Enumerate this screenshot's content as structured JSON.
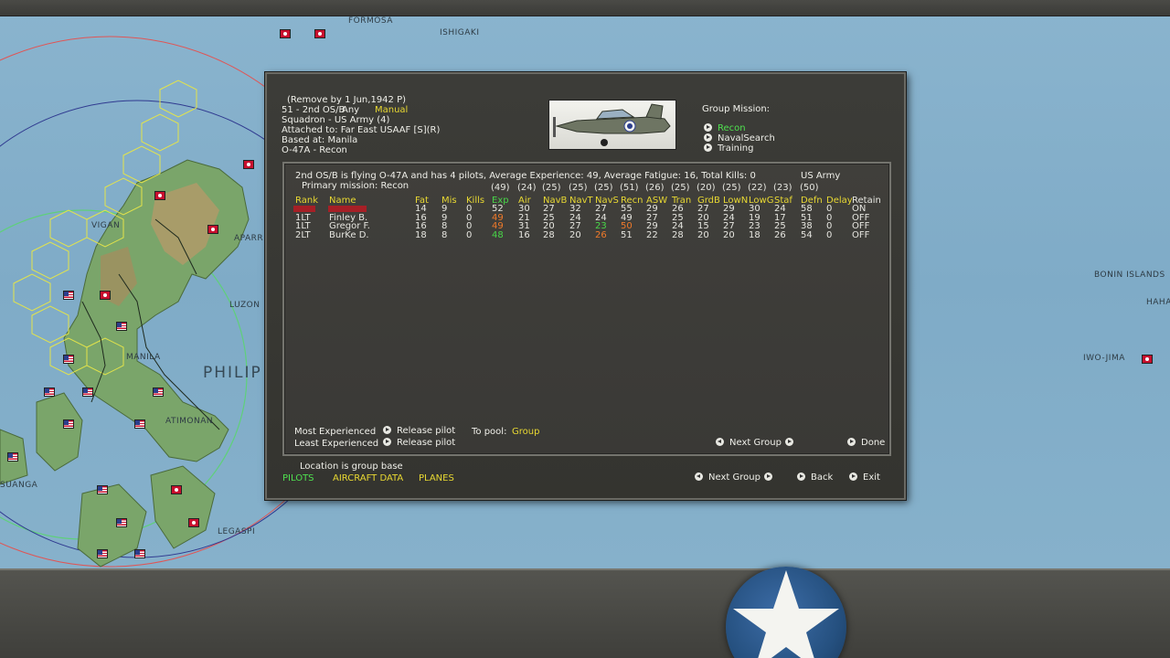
{
  "map": {
    "labels": [
      {
        "text": "FORMOSA"
      },
      {
        "text": "ISHIGAKI"
      },
      {
        "text": "VIGAN"
      },
      {
        "text": "APARRI"
      },
      {
        "text": "LUZON"
      },
      {
        "text": "MANILA"
      },
      {
        "text": "PHILIP"
      },
      {
        "text": "ATIMONAN"
      },
      {
        "text": "SUANGA"
      },
      {
        "text": "LEGASPI"
      },
      {
        "text": "BONIN ISLANDS"
      },
      {
        "text": "HAHA"
      },
      {
        "text": "IWO-JIMA"
      }
    ]
  },
  "group": {
    "remove_by": "(Remove by  1 Jun,1942  P)",
    "unit_line_prefix": "51 - 2nd OS/B",
    "unit_line_any": "Any",
    "unit_line_mode": "Manual",
    "squadron": "Squadron - US Army (4)",
    "attached_to": "Attached to: Far East USAAF [S](R)",
    "based_at": "Based at:  Manila",
    "aircraft_type": "O-47A - Recon"
  },
  "mission": {
    "title": "Group Mission:",
    "options": [
      {
        "label": "Recon",
        "selected": true
      },
      {
        "label": "NavalSearch",
        "selected": false
      },
      {
        "label": "Training",
        "selected": false
      }
    ]
  },
  "roster": {
    "summary": "2nd OS/B is flying O-47A and has 4 pilots,  Average Experience: 49,  Average Fatigue: 16, Total Kills: 0",
    "service": "US Army",
    "primary_mission": "Primary mission: Recon",
    "averages": [
      "(49)",
      "(24)",
      "(25)",
      "(25)",
      "(25)",
      "(51)",
      "(26)",
      "(25)",
      "(20)",
      "(25)",
      "(22)",
      "(23)",
      "(50)"
    ],
    "columns": [
      "Rank",
      "Name",
      "Fat",
      "Mis",
      "Kills",
      "Exp",
      "Air",
      "NavB",
      "NavT",
      "NavS",
      "Recn",
      "ASW",
      "Tran",
      "GrdB",
      "LowN",
      "LowG",
      "Staf",
      "Defn",
      "Delay",
      "Retain"
    ],
    "rows": [
      [
        "",
        "",
        "14",
        "9",
        "0",
        "52",
        "30",
        "27",
        "32",
        "27",
        "55",
        "29",
        "26",
        "27",
        "29",
        "30",
        "24",
        "58",
        "0",
        "ON"
      ],
      [
        "1LT",
        "Finley B.",
        "16",
        "9",
        "0",
        "49",
        "21",
        "25",
        "24",
        "24",
        "49",
        "27",
        "25",
        "20",
        "24",
        "19",
        "17",
        "51",
        "0",
        "OFF"
      ],
      [
        "1LT",
        "Gregor F.",
        "16",
        "8",
        "0",
        "49",
        "31",
        "20",
        "27",
        "23",
        "50",
        "29",
        "24",
        "15",
        "27",
        "23",
        "25",
        "38",
        "0",
        "OFF"
      ],
      [
        "2LT",
        "BurKe D.",
        "18",
        "8",
        "0",
        "48",
        "16",
        "28",
        "20",
        "26",
        "51",
        "22",
        "28",
        "20",
        "20",
        "18",
        "26",
        "54",
        "0",
        "OFF"
      ]
    ],
    "most_experienced": "Most Experienced",
    "least_experienced": "Least Experienced",
    "release_pilot": "Release pilot",
    "to_pool_label": "To pool:",
    "to_pool_value": "Group",
    "next_group": "Next Group",
    "done": "Done"
  },
  "footer": {
    "location_note": "Location is group base",
    "tab_pilots": "PILOTS",
    "tab_aircraft_data": "AIRCRAFT DATA",
    "tab_planes": "PLANES",
    "next_group": "Next Group",
    "back": "Back",
    "exit": "Exit"
  },
  "colors": {
    "header_yellow": "#e8d832",
    "selected_green": "#4fe04f",
    "low_orange": "#f07a2a",
    "high_green": "#48d648",
    "highlight_red": "#e0202a"
  }
}
